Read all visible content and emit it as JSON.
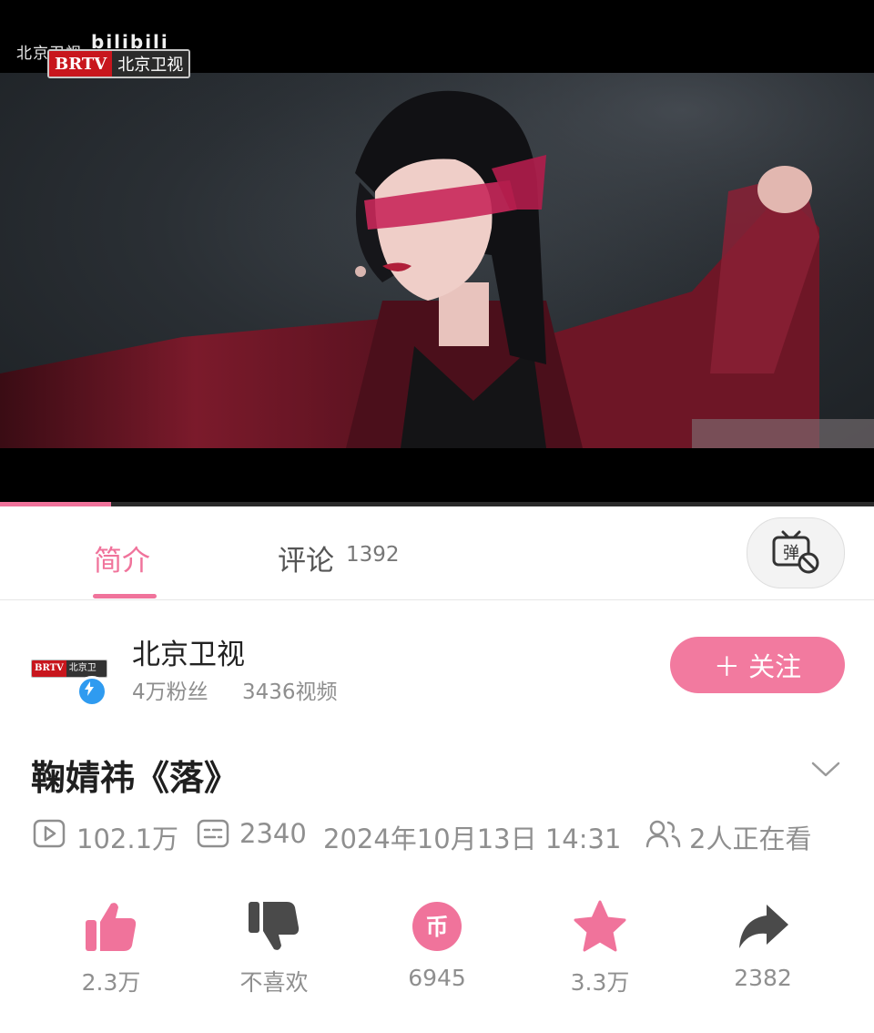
{
  "video": {
    "watermark_text": "北京卫视",
    "platform_watermark": "bilibili",
    "station_logo_latin": "BRTV",
    "station_logo_cn": "北京卫视",
    "progress": 0.127
  },
  "tabs": {
    "intro_label": "简介",
    "comments_label": "评论",
    "comments_count": "1392",
    "danmaku_icon": "danmaku-off-icon",
    "danmaku_glyph": "弹"
  },
  "uploader": {
    "avatar_logo_latin": "BRTV",
    "avatar_logo_cn": "北京卫视",
    "name": "北京卫视",
    "fans": "4万粉丝",
    "videos": "3436视频",
    "follow_label": "＋ 关注"
  },
  "video_info": {
    "title": "鞠婧祎《落》",
    "views": "102.1万",
    "danmaku_count": "2340",
    "publish_time": "2024年10月13日 14:31",
    "watching": "2人正在看"
  },
  "actions": [
    {
      "icon": "thumbs-up-icon",
      "label": "2.3万"
    },
    {
      "icon": "thumbs-down-icon",
      "label": "不喜欢"
    },
    {
      "icon": "coin-icon",
      "label": "6945",
      "glyph": "币"
    },
    {
      "icon": "star-icon",
      "label": "3.3万"
    },
    {
      "icon": "share-icon",
      "label": "2382"
    }
  ],
  "colors": {
    "accent": "#f0739b",
    "follow_button": "#f27a9f",
    "text_secondary": "#8f8f8f",
    "dislike_icon": "#4a4a4a"
  }
}
